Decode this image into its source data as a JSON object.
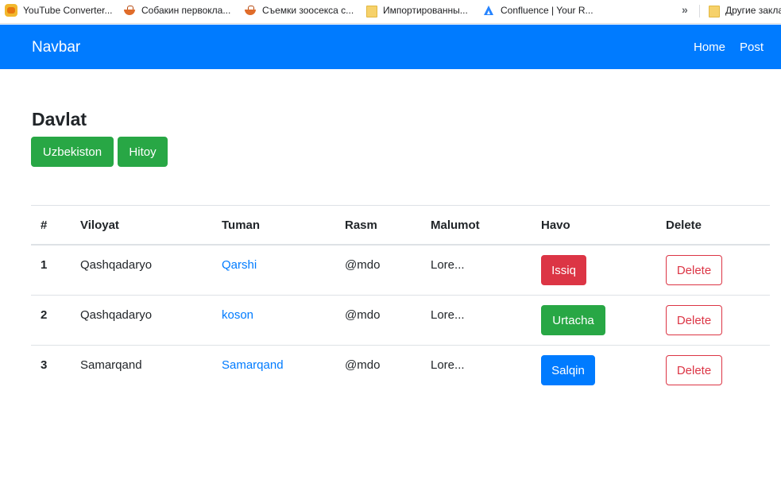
{
  "bookmarks": [
    {
      "label": "YouTube Converter...",
      "icon": "youtube-converter-icon"
    },
    {
      "label": "Собакин первокла...",
      "icon": "bowl-icon"
    },
    {
      "label": "Съемки зоосекса с...",
      "icon": "bowl-icon"
    },
    {
      "label": "Импортированны...",
      "icon": "folder-icon"
    },
    {
      "label": "Confluence | Your R...",
      "icon": "confluence-icon"
    },
    {
      "label": "Другие закла",
      "icon": "folder-icon"
    }
  ],
  "bookmarks_more": "»",
  "navbar": {
    "brand": "Navbar",
    "links": [
      "Home",
      "Post"
    ],
    "color": "#007bff"
  },
  "heading": "Davlat",
  "country_buttons": [
    "Uzbekiston",
    "Hitoy"
  ],
  "table": {
    "headers": [
      "#",
      "Viloyat",
      "Tuman",
      "Rasm",
      "Malumot",
      "Havo",
      "Delete"
    ],
    "rows": [
      {
        "num": "1",
        "viloyat": "Qashqadaryo",
        "tuman": "Qarshi",
        "rasm": "@mdo",
        "malumot": "Lore...",
        "havo": "Issiq",
        "havo_style": "danger",
        "delete": "Delete"
      },
      {
        "num": "2",
        "viloyat": "Qashqadaryo",
        "tuman": "koson",
        "rasm": "@mdo",
        "malumot": "Lore...",
        "havo": "Urtacha",
        "havo_style": "success",
        "delete": "Delete"
      },
      {
        "num": "3",
        "viloyat": "Samarqand",
        "tuman": "Samarqand",
        "rasm": "@mdo",
        "malumot": "Lore...",
        "havo": "Salqin",
        "havo_style": "primary",
        "delete": "Delete"
      }
    ]
  },
  "colors": {
    "success": "#28a745",
    "danger": "#dc3545",
    "primary": "#007bff"
  }
}
